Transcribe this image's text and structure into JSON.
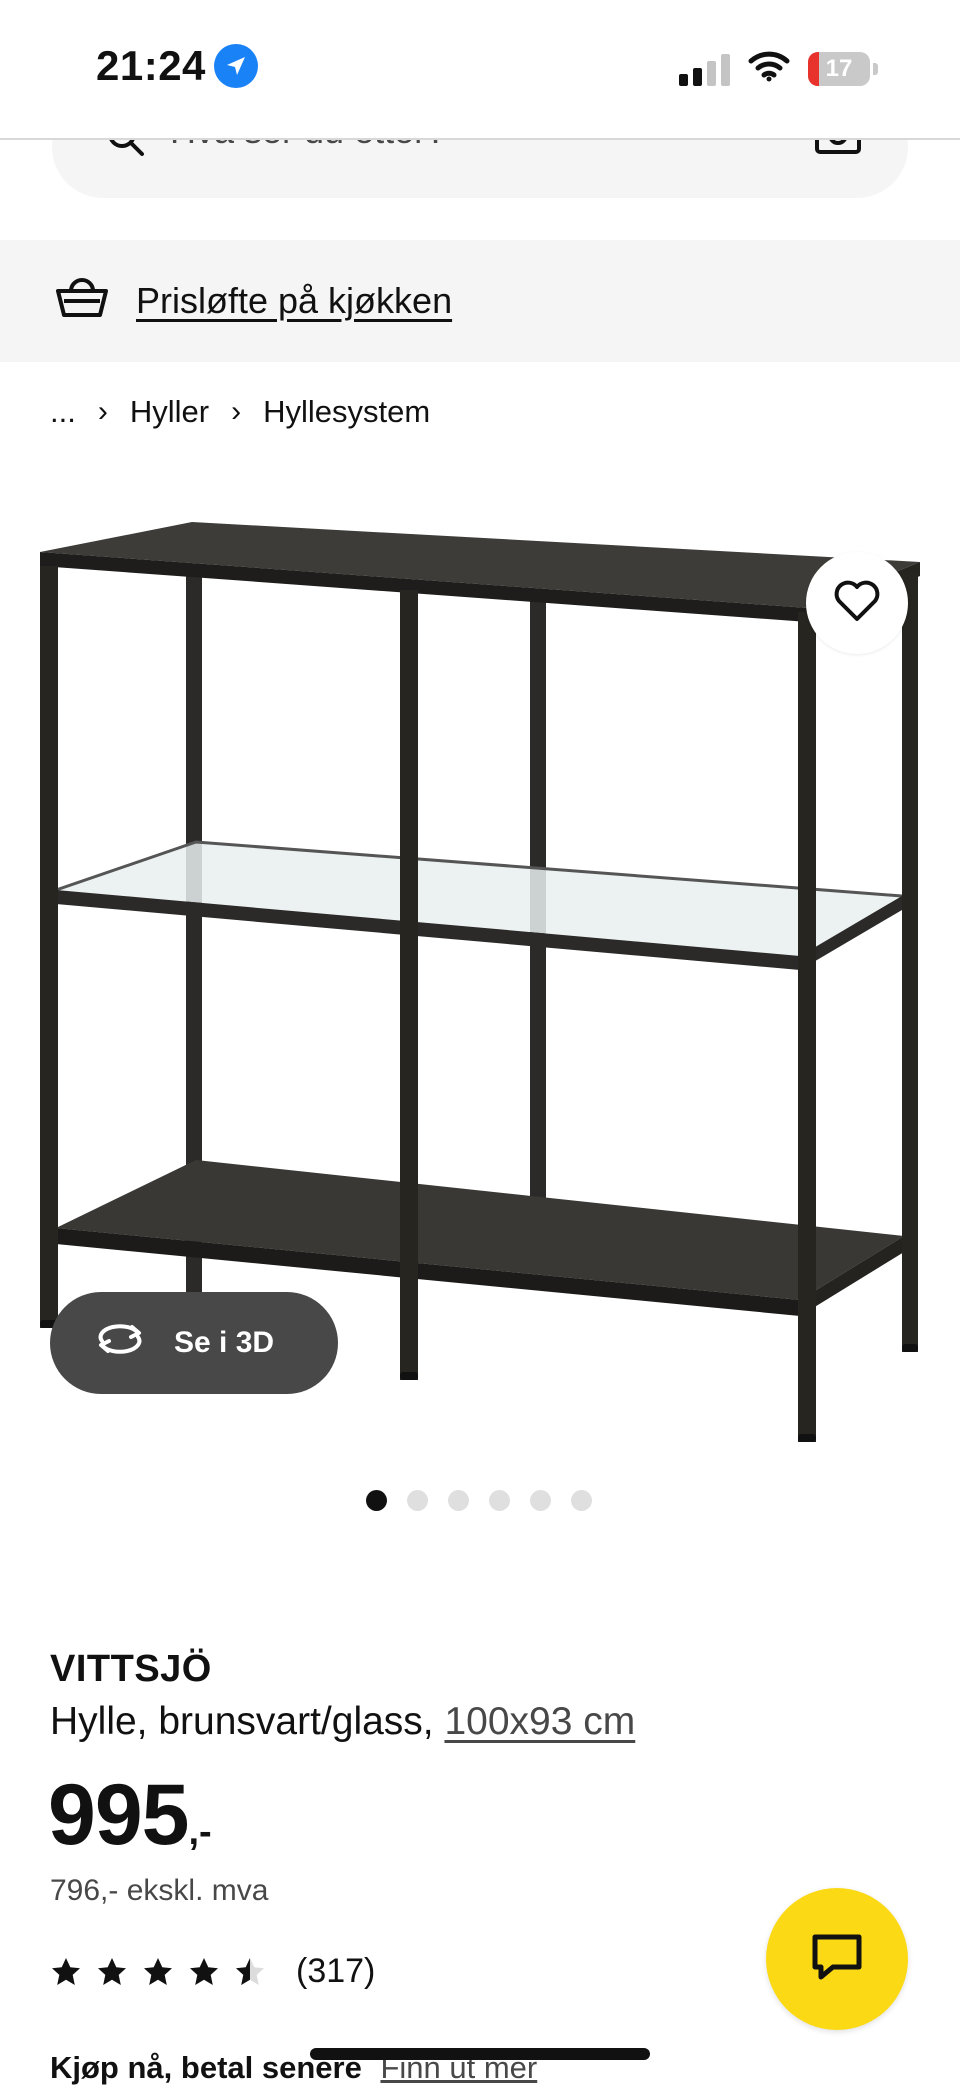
{
  "status_bar": {
    "time": "21:24",
    "battery_level": "17"
  },
  "search": {
    "placeholder": "Hva ser du etter?"
  },
  "promo": {
    "link_text": "Prisløfte på kjøkken"
  },
  "breadcrumb": {
    "items": [
      "...",
      "Hyller",
      "Hyllesystem"
    ]
  },
  "gallery": {
    "view3d_label": "Se i 3D",
    "image_count": 6,
    "active_index": 0
  },
  "product": {
    "name": "VITTSJÖ",
    "description": "Hylle, brunsvart/glass,",
    "size": "100x93 cm",
    "price": "995",
    "price_suffix": ",-",
    "price_excl_vat": "796,- ekskl. mva",
    "rating_value": 4.5,
    "rating_count": "(317)"
  },
  "payment": {
    "bold_text": "Kjøp nå, betal senere",
    "link_text": "Finn ut mer"
  },
  "colors": {
    "chat_button": "#fbd914",
    "location_icon": "#1a82f7",
    "battery_low": "#e8322c"
  }
}
